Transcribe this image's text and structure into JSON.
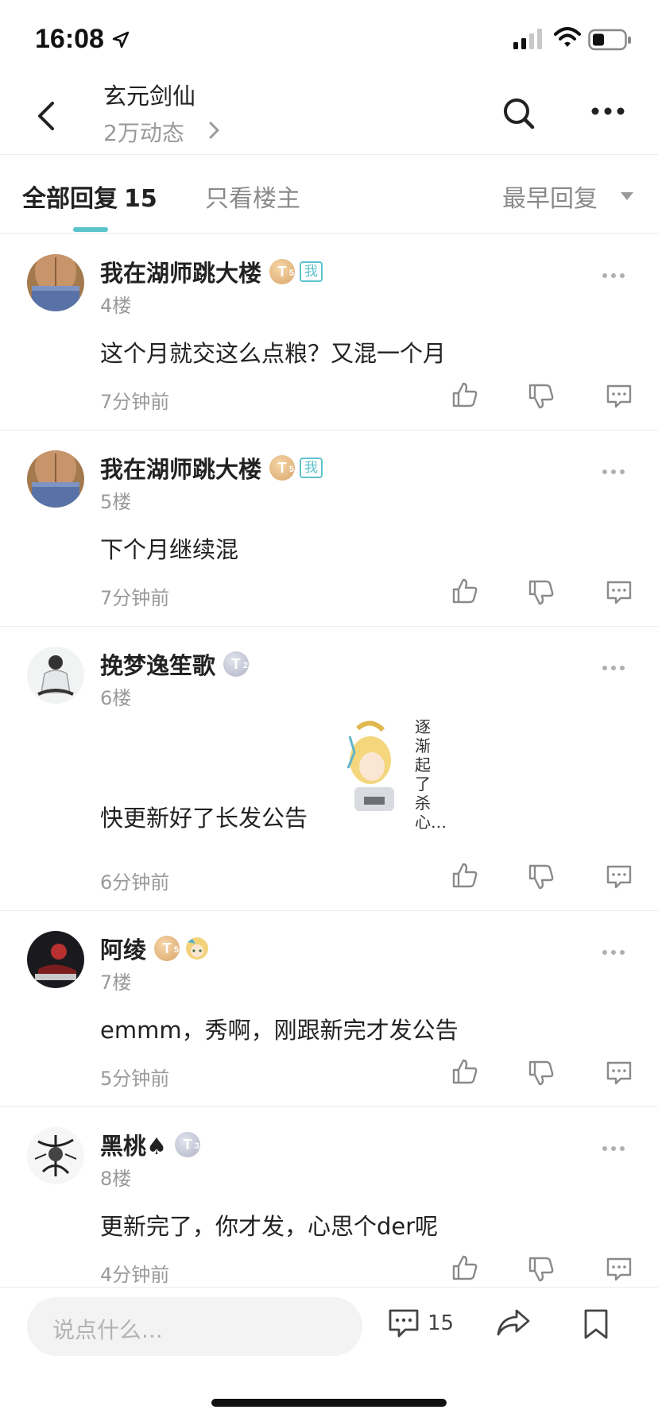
{
  "status_bar": {
    "time": "16:08"
  },
  "header": {
    "title": "玄元剑仙",
    "subtitle": "2万动态"
  },
  "tabs": {
    "all_label": "全部回复",
    "all_count": "15",
    "op_only": "只看楼主",
    "sort": "最早回复"
  },
  "posts": [
    {
      "name": "我在湖师跳大楼",
      "level": "5",
      "level_color": "gold",
      "me_badge": "我",
      "floor": "4楼",
      "content": "这个月就交这么点粮？又混一个月",
      "time": "7分钟前"
    },
    {
      "name": "我在湖师跳大楼",
      "level": "5",
      "level_color": "gold",
      "me_badge": "我",
      "floor": "5楼",
      "content": "下个月继续混",
      "time": "7分钟前"
    },
    {
      "name": "挽梦逸笙歌",
      "level": "2",
      "level_color": "silver",
      "floor": "6楼",
      "content": "快更新好了长发公告",
      "time": "6分钟前",
      "sticker_text": "逐渐起了杀心…"
    },
    {
      "name": "阿绫",
      "level": "5",
      "level_color": "gold",
      "floor": "7楼",
      "content": "emmm，秀啊，刚跟新完才发公告",
      "time": "5分钟前"
    },
    {
      "name": "黑桃♠",
      "level": "3",
      "level_color": "silver",
      "floor": "8楼",
      "content": "更新完了，你才发，心思个der呢",
      "time": "4分钟前"
    }
  ],
  "level_letter": "T",
  "bottom": {
    "placeholder": "说点什么...",
    "comment_count": "15"
  },
  "colors": {
    "accent": "#5dc3cd",
    "gold_badge": "#d9a56a",
    "silver_badge": "#aeb3c4",
    "muted": "#9a9a9a"
  }
}
